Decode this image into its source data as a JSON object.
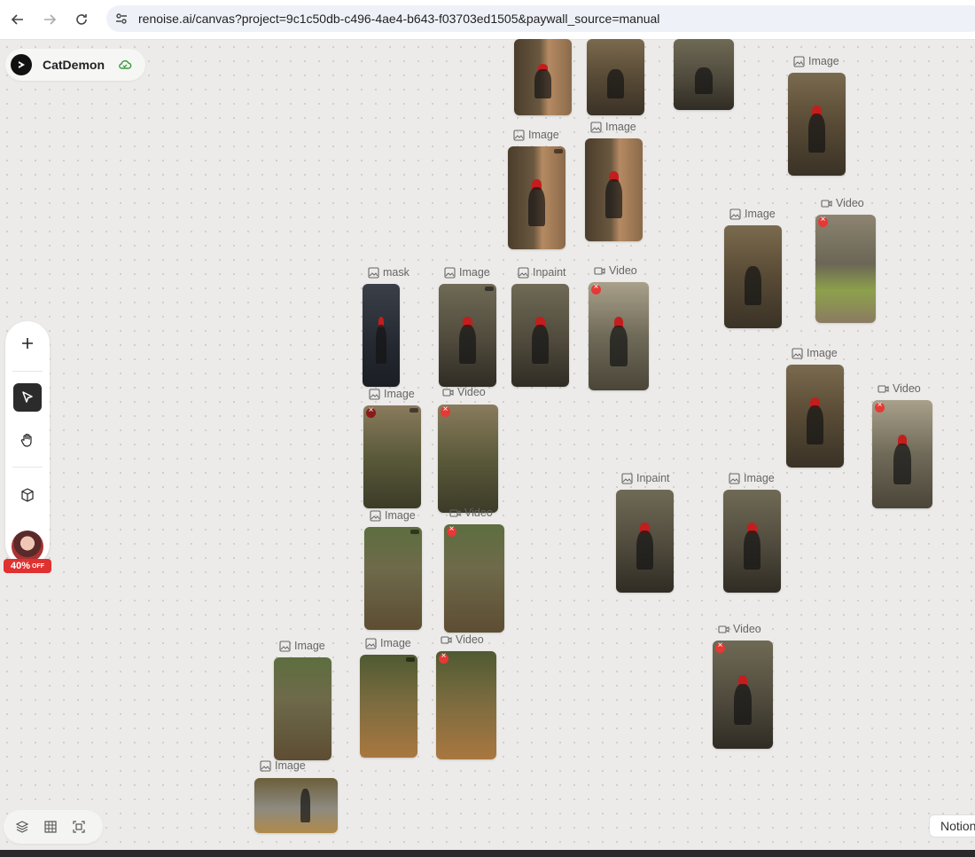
{
  "browser": {
    "url": "renoise.ai/canvas?project=9c1c50db-c496-4ae4-b643-f03703ed1505&paywall_source=manual"
  },
  "project": {
    "name": "CatDemon"
  },
  "promo": {
    "value": "40%",
    "suffix": "OFF"
  },
  "notion_tab": {
    "label": "Notion"
  },
  "nodes": {
    "n1": "Image",
    "n2": "Image",
    "n3": "Image",
    "n4": "Image",
    "n5": "Video",
    "n6": "mask",
    "n7": "Image",
    "n8": "Inpaint",
    "n9": "Video",
    "n10": "Image",
    "n11": "Video",
    "n12": "Image",
    "n13": "Video",
    "n14": "Image",
    "n15": "Video",
    "n16": "Inpaint",
    "n17": "Image",
    "n18": "Image",
    "n19": "Image",
    "n20": "Video",
    "n21": "Video",
    "n22": "Image"
  }
}
